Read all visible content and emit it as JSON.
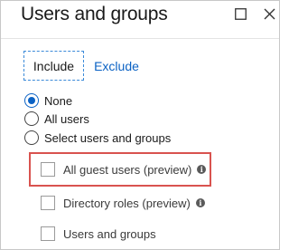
{
  "header": {
    "title": "Users and groups"
  },
  "tabs": [
    {
      "label": "Include",
      "active": true
    },
    {
      "label": "Exclude",
      "active": false
    }
  ],
  "radios": [
    {
      "label": "None",
      "checked": true
    },
    {
      "label": "All users",
      "checked": false
    },
    {
      "label": "Select users and groups",
      "checked": false
    }
  ],
  "checkboxes": [
    {
      "label": "All guest users (preview)",
      "checked": false,
      "has_info": true
    },
    {
      "label": "Directory roles (preview)",
      "checked": false,
      "has_info": true
    },
    {
      "label": "Users and groups",
      "checked": false,
      "has_info": false
    }
  ],
  "icons": {
    "maximize": "maximize-icon",
    "close": "close-icon",
    "info": "info-icon"
  },
  "colors": {
    "accent": "#0b62c4",
    "highlight_border": "#d9534f",
    "tab_focus_border": "#3b8ad9"
  }
}
